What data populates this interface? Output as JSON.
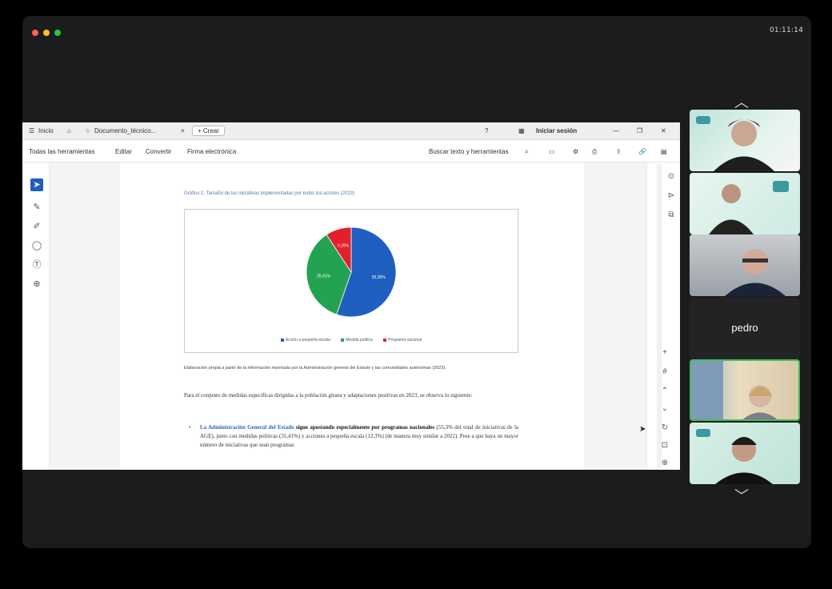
{
  "window": {
    "time": "01:11:14",
    "traffic_lights": [
      "#ff5f57",
      "#febc2e",
      "#28c840"
    ]
  },
  "app": {
    "home_label": "Inicio",
    "tab_title": "Documento_técnico...",
    "new_tab_label": "+ Crear",
    "signin_label": "Iniciar sesión",
    "menus": [
      "Todas las herramientas",
      "Editar",
      "Convertir",
      "Firma electrónica"
    ],
    "search_label": "Buscar texto y herramientas"
  },
  "document": {
    "figure_caption": "Gráfico 2. Tamaño de las iniciativas implementadas por todos los actores (2023)",
    "source_note": "Elaboración propia a partir de la información reportada por la Administración general del Estado y las comunidades autónomas (2023).",
    "intro_paragraph": "Para el conjunto de medidas específicas dirigidas a la población gitana y adaptaciones positivas en 2023, se observa lo siguiente:",
    "bullet": {
      "highlight": "La Administración General del Estado",
      "bold": "sigue apostando especialmente por programas nacionales",
      "rest": "(55,3% del total de iniciativas de la AGE), junto con medidas políticas (35,41%) y acciones a pequeña escala (12,3%) (de manera muy similar a 2022). Pese a que haya un mayor número de iniciativas que sean programas"
    }
  },
  "chart_data": {
    "type": "pie",
    "labels": [
      "Acción a pequeña escala",
      "Medida política",
      "Programa nacional"
    ],
    "values": [
      55.3,
      35.41,
      9.29
    ],
    "value_labels": [
      "55,30%",
      "35,41%",
      "9,29%"
    ],
    "colors": [
      "#1f5fbf",
      "#23a352",
      "#e1202b"
    ],
    "legend": "bottom"
  },
  "participants": [
    {
      "id": "p1",
      "type": "video",
      "label": ""
    },
    {
      "id": "p2",
      "type": "video",
      "label": ""
    },
    {
      "id": "p3",
      "type": "video",
      "label": ""
    },
    {
      "id": "p4",
      "type": "name",
      "label": "pedro"
    },
    {
      "id": "p5",
      "type": "video",
      "label": ""
    },
    {
      "id": "p6",
      "type": "video",
      "label": ""
    }
  ]
}
